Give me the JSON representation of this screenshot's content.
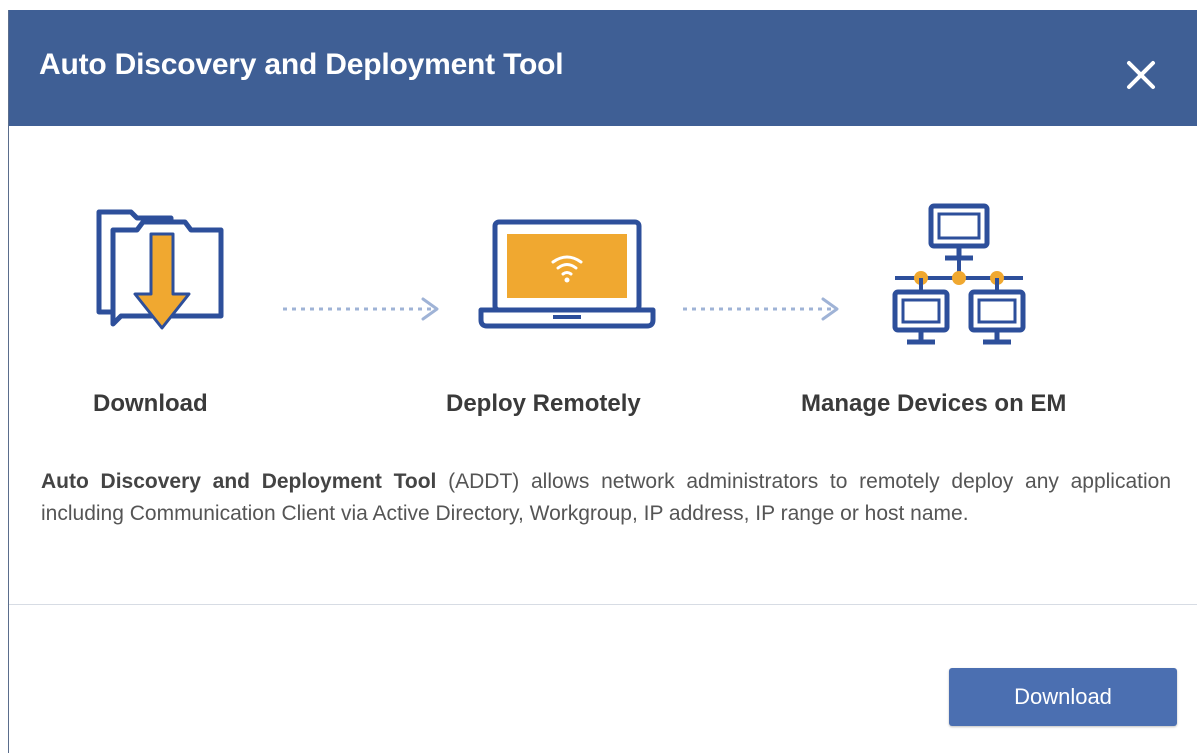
{
  "dialog": {
    "title": "Auto Discovery and Deployment Tool",
    "close_icon": "close-icon"
  },
  "steps": [
    {
      "label": "Download",
      "icon": "download-folder-icon"
    },
    {
      "label": "Deploy Remotely",
      "icon": "laptop-wifi-icon"
    },
    {
      "label": "Manage Devices on EM",
      "icon": "network-devices-icon"
    }
  ],
  "description": {
    "bold": "Auto Discovery and Deployment Tool",
    "rest": " (ADDT) allows network administrators to remotely deploy any application including Communication Client via Active Directory, Workgroup, IP address, IP range or host name."
  },
  "footer": {
    "download_label": "Download"
  },
  "colors": {
    "header": "#3f5f95",
    "icon_stroke": "#2d4f9b",
    "icon_accent": "#f0a830",
    "button": "#4b6fb1"
  }
}
